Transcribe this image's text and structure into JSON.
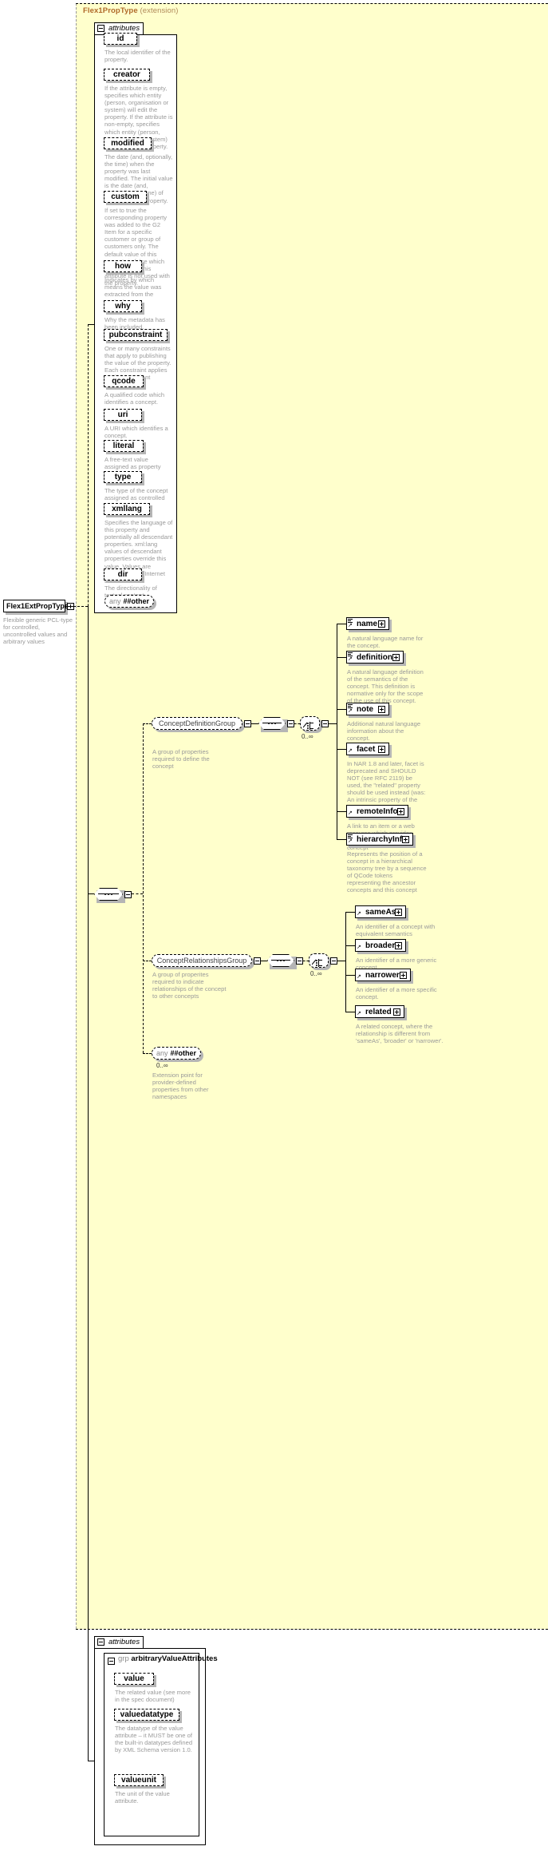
{
  "diagram": {
    "title": "Flex1PropType",
    "title_suffix": "(extension)",
    "root": {
      "label": "Flex1ExtPropType",
      "description": "Flexible generic PCL-type for controlled, uncontrolled values and arbitrary values"
    },
    "attributes_tab_label": "attributes",
    "group_label_prefix": "grp",
    "group_label": "arbitraryValueAttributes",
    "multiplicity": "0..∞"
  },
  "attributes": [
    {
      "name": "id",
      "desc": "The local identifier of the property."
    },
    {
      "name": "creator",
      "desc": "If the attribute is empty, specifies which entity (person, organisation or system) will edit the property. If the attribute is non-empty, specifies which entity (person, organisation or system) has edited the property."
    },
    {
      "name": "modified",
      "desc": "The date (and, optionally, the time) when the property was last modified. The initial value is the date (and, optionally, the time) of creation of the property."
    },
    {
      "name": "custom",
      "desc": "If set to true the corresponding property was added to the G2 Item for a specific customer or group of customers only. The default value of this property is false which applies when this attribute is not used with the property."
    },
    {
      "name": "how",
      "desc": "Indicates by which means the value was extracted from the content."
    },
    {
      "name": "why",
      "desc": "Why the metadata has been included."
    },
    {
      "name": "pubconstraint",
      "desc": "One or many constraints that apply to publishing the value of the property. Each constraint applies to all descendant elements."
    },
    {
      "name": "qcode",
      "desc": "A qualified code which identifies a concept."
    },
    {
      "name": "uri",
      "desc": "A URI which identifies a concept."
    },
    {
      "name": "literal",
      "desc": "A free-text value assigned as property value."
    },
    {
      "name": "type",
      "desc": "The type of the concept assigned as controlled property value."
    },
    {
      "name": "xmllang",
      "desc": "Specifies the language of this property and potentially all descendant properties. xml:lang values of descendant properties override this value. Values are determined by Internet BCP 47."
    },
    {
      "name": "dir",
      "desc": "The directionality of textual content."
    }
  ],
  "any_other_top": {
    "prefix": "any",
    "label": "##other"
  },
  "concept_definition_group": {
    "label": "ConceptDefinitionGroup",
    "desc": "A group of properties required to define the concept",
    "multiplicity": "0..∞",
    "elements": [
      {
        "name": "name",
        "desc": "A natural language name for the concept."
      },
      {
        "name": "definition",
        "desc": "A natural language definition of the semantics of the concept. This definition is normative only for the scope of the use of this concept."
      },
      {
        "name": "note",
        "desc": "Additional natural language information about the concept."
      },
      {
        "name": "facet",
        "desc": "In NAR 1.8 and later, facet is deprecated and SHOULD NOT (see RFC 2119) be used, the \"related\" property should be used instead (was: An intrinsic property of the concept.)"
      },
      {
        "name": "remoteInfo",
        "desc": "A link to an item or a web resource which provides information about the concept"
      },
      {
        "name": "hierarchyInfo",
        "desc": "Represents the position of a concept in a hierarchical taxonomy tree by a sequence of QCode tokens representing the ancestor concepts and this concept"
      }
    ]
  },
  "concept_relationships_group": {
    "label": "ConceptRelationshipsGroup",
    "desc": "A group of properites required to indicate relationships of the concept to other concepts",
    "multiplicity": "0..∞",
    "elements": [
      {
        "name": "sameAs",
        "desc": "An identifier of a concept with equivalent semantics"
      },
      {
        "name": "broader",
        "desc": "An identifier of a more generic concept."
      },
      {
        "name": "narrower",
        "desc": "An identifier of a more specific concept."
      },
      {
        "name": "related",
        "desc": "A related concept, where the relationship is different from 'sameAs', 'broader' or 'narrower'."
      }
    ]
  },
  "any_other_inner": {
    "prefix": "any",
    "label": "##other",
    "multiplicity": "0..∞",
    "desc": "Extension point for provider-defined properties from other namespaces"
  },
  "value_attributes": [
    {
      "name": "value",
      "desc": "The related value (see more in the spec document)"
    },
    {
      "name": "valuedatatype",
      "desc": "The datatype of the value attribute – it MUST be one of the built-in datatypes defined by XML Schema version 1.0."
    },
    {
      "name": "valueunit",
      "desc": "The unit of the value attribute."
    }
  ]
}
